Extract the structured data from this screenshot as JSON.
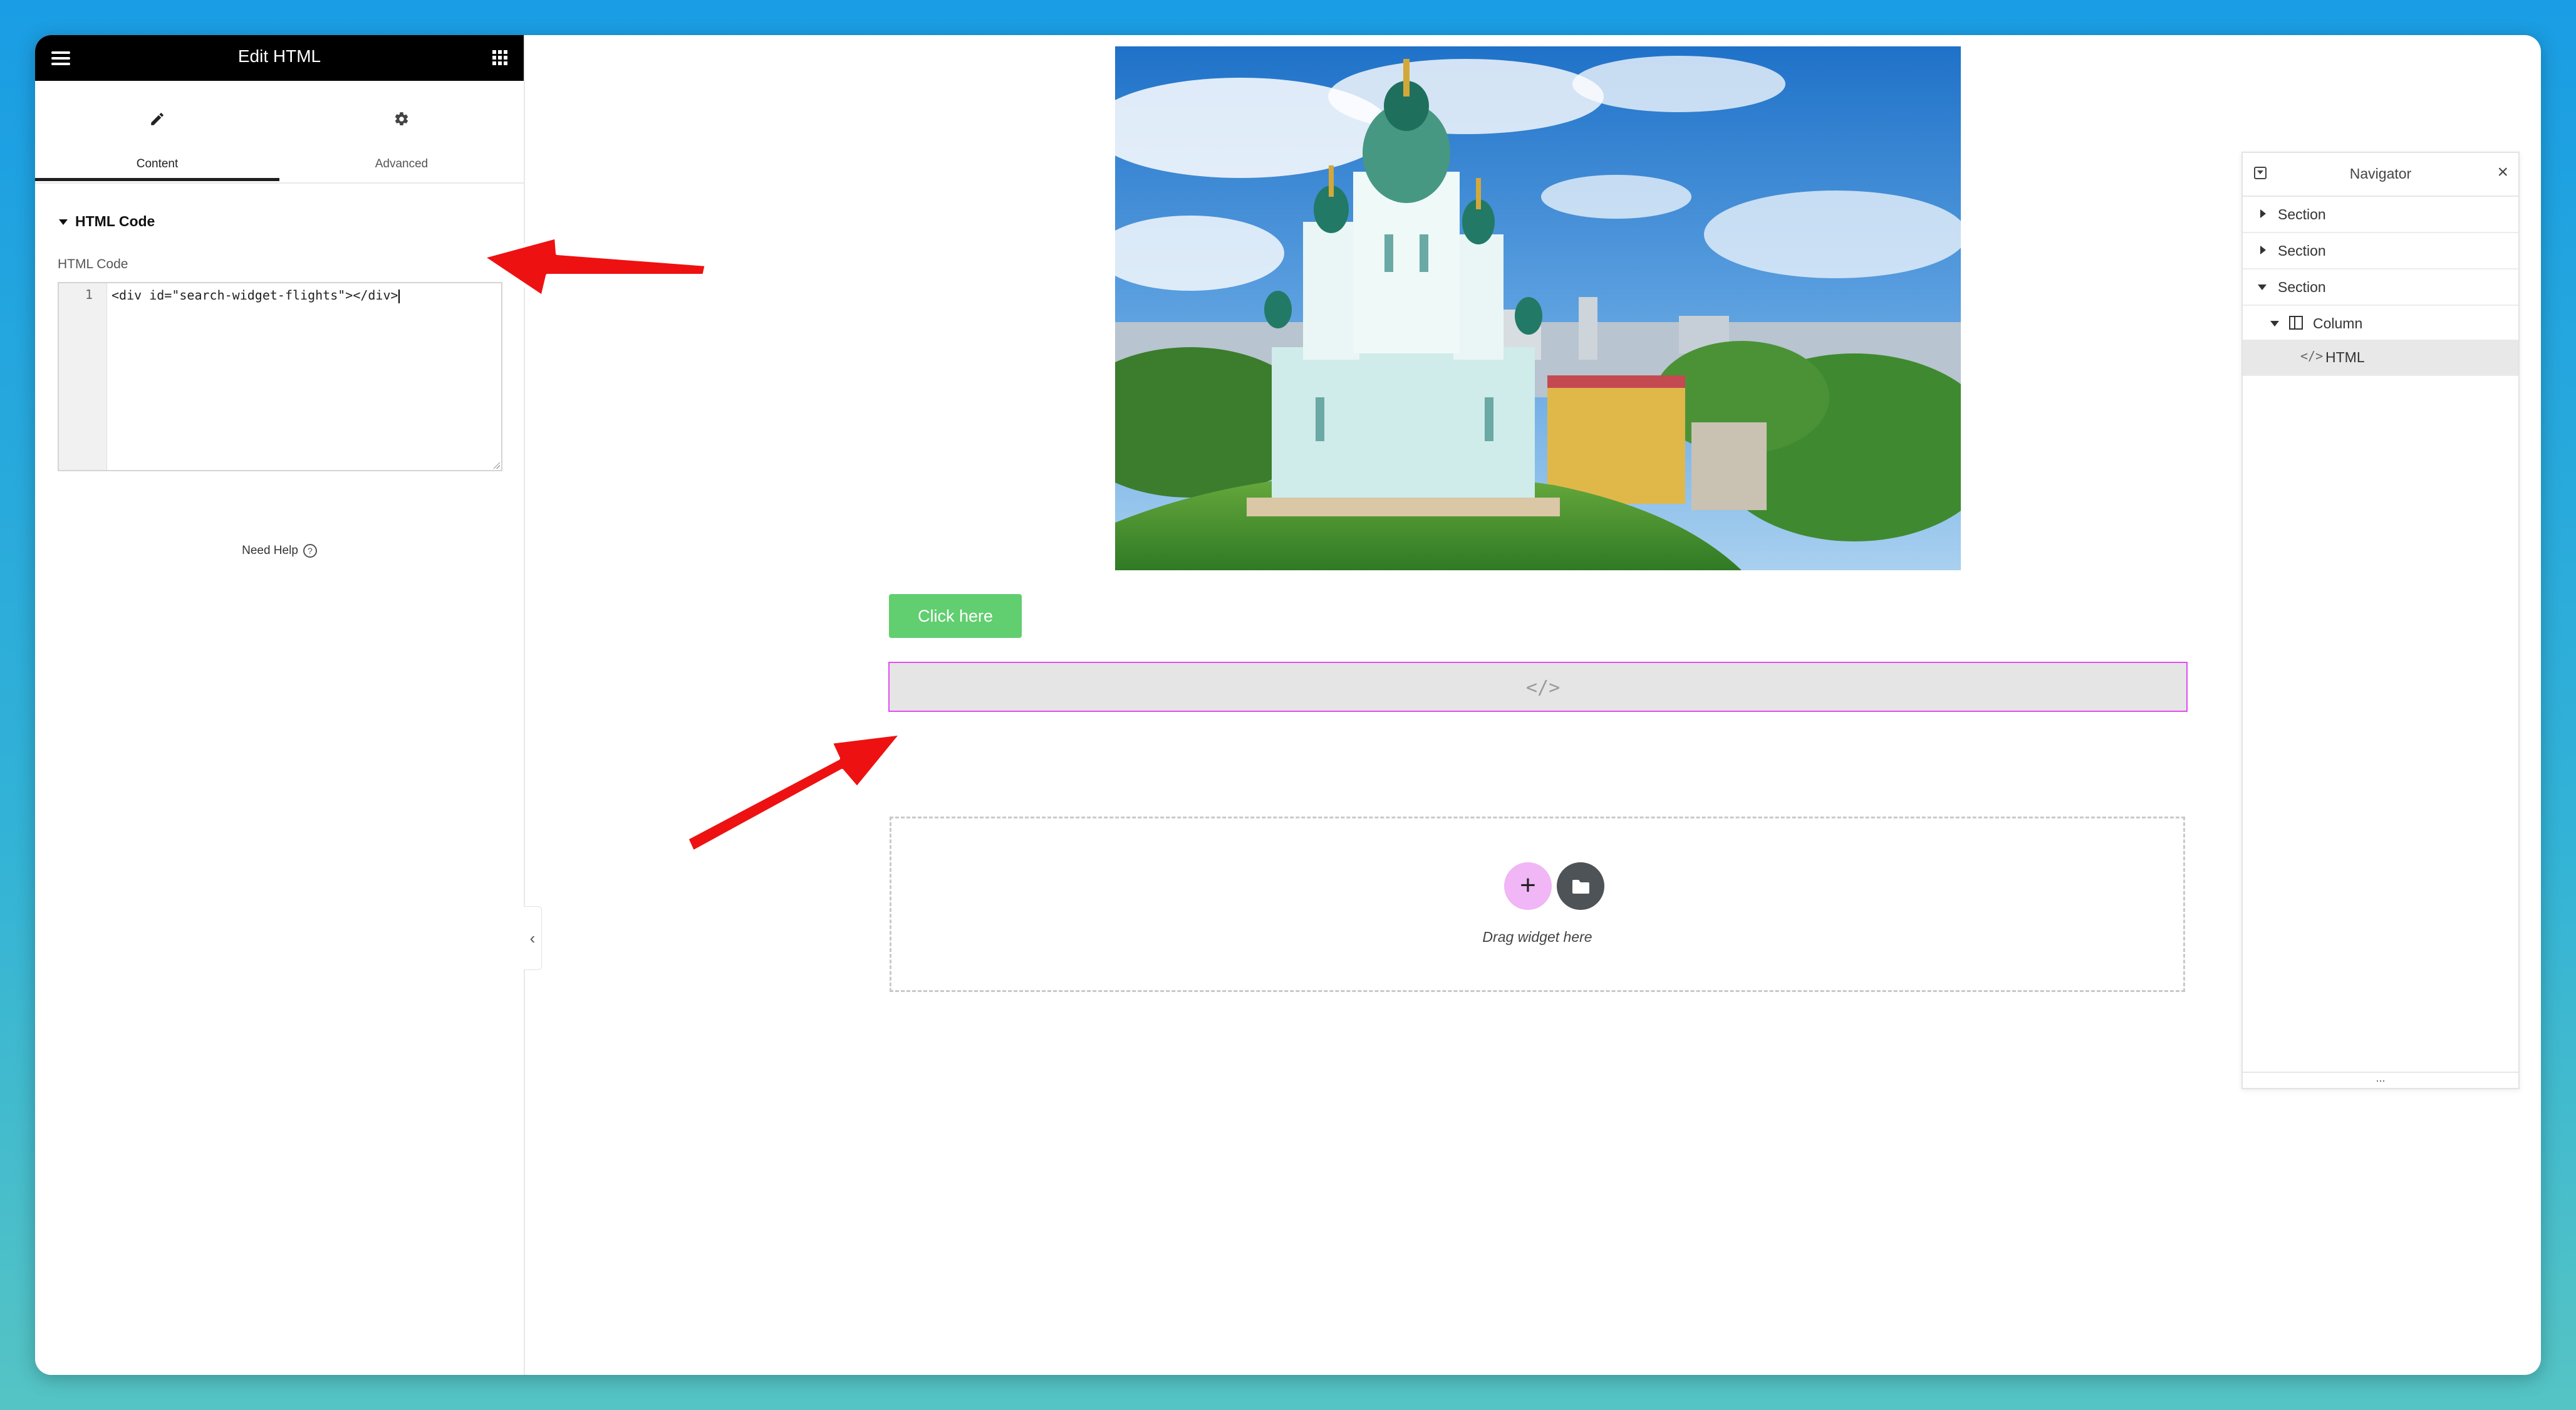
{
  "panel": {
    "title": "Edit HTML",
    "tabs": [
      {
        "label": "Content",
        "icon": "pencil-icon",
        "active": true
      },
      {
        "label": "Advanced",
        "icon": "gear-icon",
        "active": false
      }
    ],
    "section_title": "HTML Code",
    "field_label": "HTML Code",
    "code": {
      "line_number": "1",
      "value": "<div id=\"search-widget-flights\"></div>"
    },
    "need_help": "Need Help",
    "help_icon_glyph": "?",
    "collapse_glyph": "‹"
  },
  "canvas": {
    "button_label": "Click here",
    "html_widget_icon": "</>",
    "drop_zone": {
      "add_glyph": "+",
      "text": "Drag widget here"
    }
  },
  "navigator": {
    "title": "Navigator",
    "close_glyph": "×",
    "items": [
      {
        "label": "Section",
        "expanded": false
      },
      {
        "label": "Section",
        "expanded": false
      },
      {
        "label": "Section",
        "expanded": true
      },
      {
        "label": "Column",
        "expanded": true
      },
      {
        "label": "HTML",
        "active": true
      }
    ],
    "footer": "..."
  },
  "colors": {
    "accent_pink": "#e04df0",
    "button_green": "#61ce70",
    "annotation_red": "#ee1111"
  }
}
